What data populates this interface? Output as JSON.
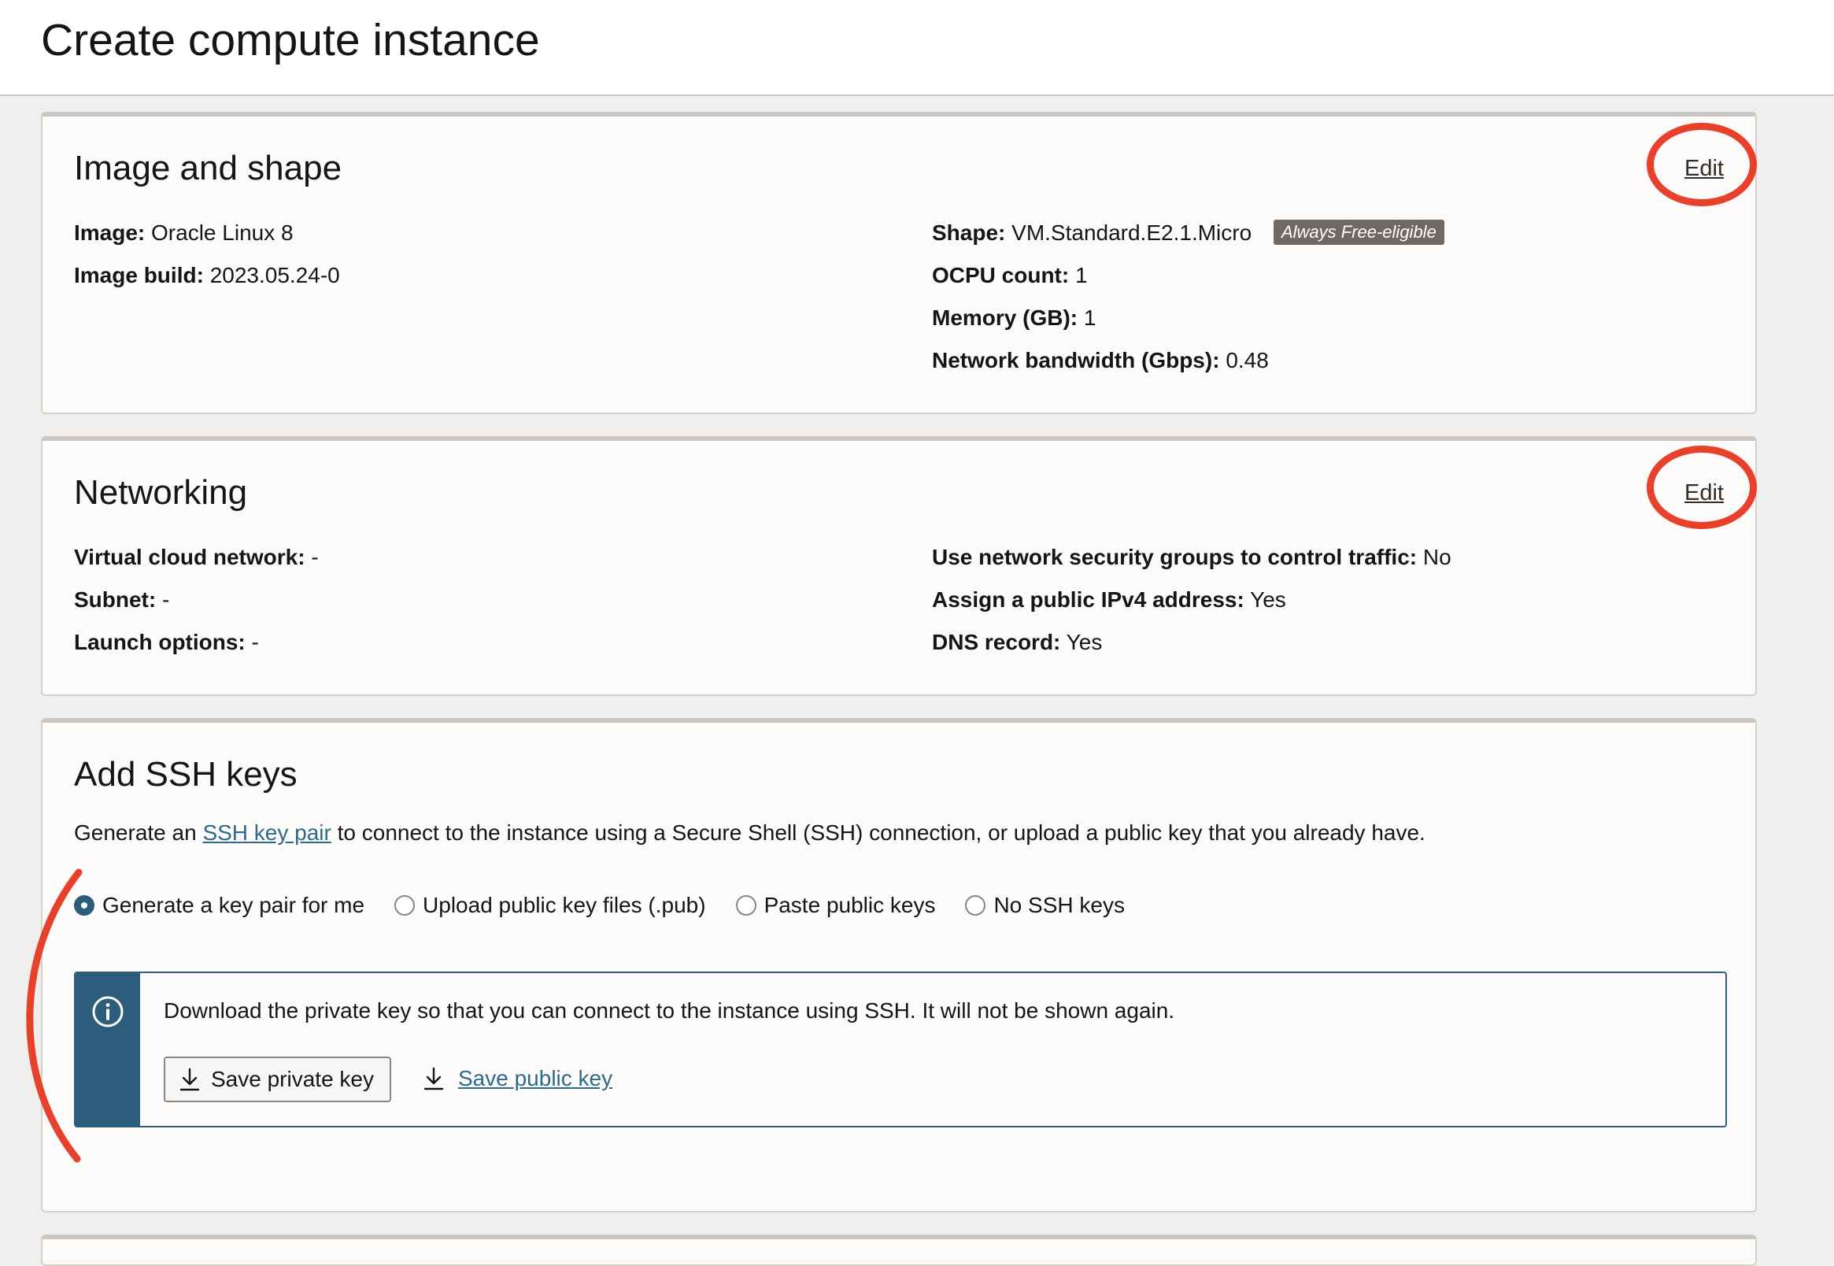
{
  "page": {
    "title": "Create compute instance"
  },
  "image_shape": {
    "title": "Image and shape",
    "edit_label": "Edit",
    "left": [
      {
        "key": "Image:",
        "value": "Oracle Linux 8"
      },
      {
        "key": "Image build:",
        "value": "2023.05.24-0"
      }
    ],
    "right": [
      {
        "key": "Shape:",
        "value": "VM.Standard.E2.1.Micro"
      },
      {
        "key": "OCPU count:",
        "value": "1"
      },
      {
        "key": "Memory (GB):",
        "value": "1"
      },
      {
        "key": "Network bandwidth (Gbps):",
        "value": "0.48"
      }
    ],
    "badge": "Always Free-eligible"
  },
  "networking": {
    "title": "Networking",
    "edit_label": "Edit",
    "left": [
      {
        "key": "Virtual cloud network:",
        "value": "-"
      },
      {
        "key": "Subnet:",
        "value": "-"
      },
      {
        "key": "Launch options:",
        "value": "-"
      }
    ],
    "right": [
      {
        "key": "Use network security groups to control traffic:",
        "value": "No"
      },
      {
        "key": "Assign a public IPv4 address:",
        "value": "Yes"
      },
      {
        "key": "DNS record:",
        "value": "Yes"
      }
    ]
  },
  "ssh": {
    "title": "Add SSH keys",
    "desc_before": "Generate an",
    "desc_link": "SSH key pair",
    "desc_after": "to connect to the instance using a Secure Shell (SSH) connection, or upload a public key that you already have.",
    "options": [
      {
        "label": "Generate a key pair for me",
        "checked": true
      },
      {
        "label": "Upload public key files (.pub)",
        "checked": false
      },
      {
        "label": "Paste public keys",
        "checked": false
      },
      {
        "label": "No SSH keys",
        "checked": false
      }
    ],
    "info_message": "Download the private key so that you can connect to the instance using SSH. It will not be shown again.",
    "save_private_label": "Save private key",
    "save_public_label": "Save public key"
  },
  "colors": {
    "annotation": "#e8412b",
    "info_accent": "#2c5e7c",
    "link": "#2e6b8a"
  },
  "icons": [
    "info-icon",
    "download-icon",
    "radio-checked-icon",
    "radio-unchecked-icon"
  ]
}
